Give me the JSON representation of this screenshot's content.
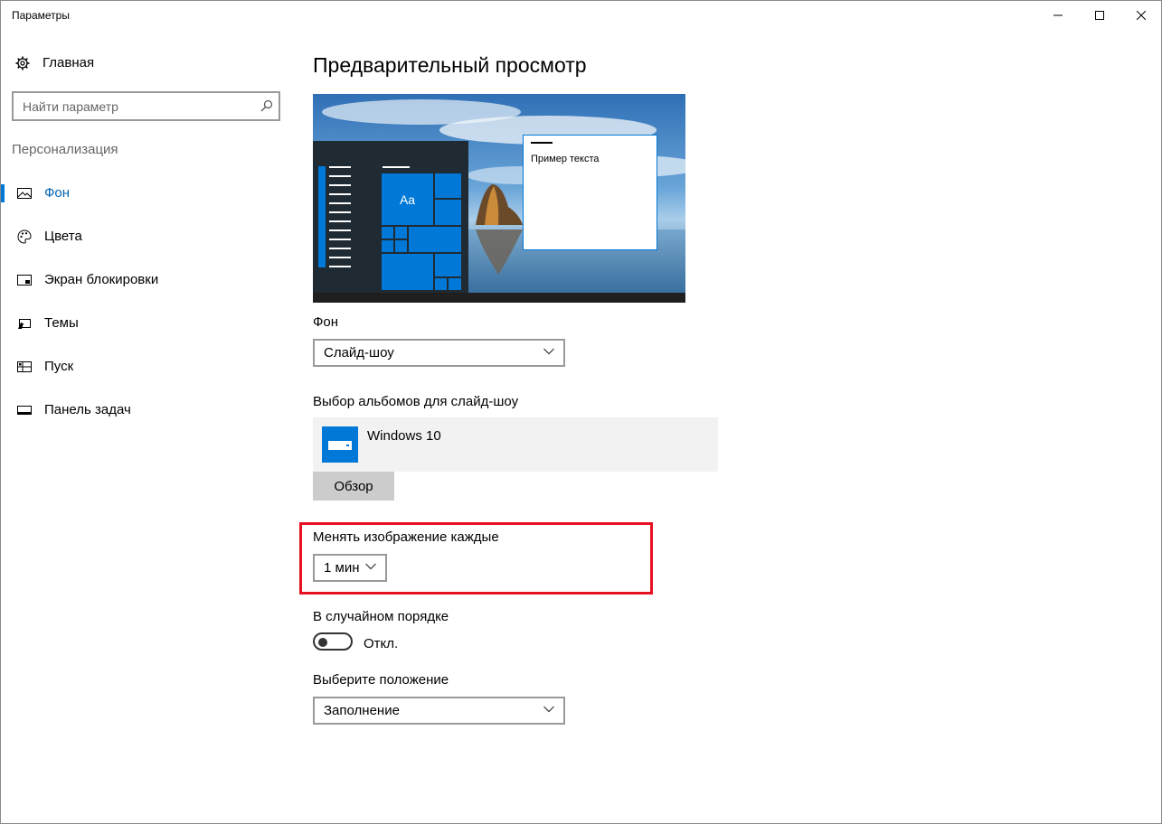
{
  "window": {
    "title": "Параметры",
    "controls": [
      "minimize",
      "maximize",
      "close"
    ]
  },
  "sidebar": {
    "home_label": "Главная",
    "search_placeholder": "Найти параметр",
    "section_title": "Персонализация",
    "items": [
      {
        "label": "Фон",
        "icon": "picture-icon",
        "active": true
      },
      {
        "label": "Цвета",
        "icon": "palette-icon",
        "active": false
      },
      {
        "label": "Экран блокировки",
        "icon": "lock-screen-icon",
        "active": false
      },
      {
        "label": "Темы",
        "icon": "themes-icon",
        "active": false
      },
      {
        "label": "Пуск",
        "icon": "start-icon",
        "active": false
      },
      {
        "label": "Панель задач",
        "icon": "taskbar-icon",
        "active": false
      }
    ]
  },
  "main": {
    "preview_title": "Предварительный просмотр",
    "preview": {
      "tile_text": "Aa",
      "sample_text": "Пример текста"
    },
    "background_label": "Фон",
    "background_value": "Слайд-шоу",
    "albums_label": "Выбор альбомов для слайд-шоу",
    "album_name": "Windows 10",
    "browse_label": "Обзор",
    "interval_label": "Менять изображение каждые",
    "interval_value": "1 мин",
    "shuffle_label": "В случайном порядке",
    "shuffle_state": "Откл.",
    "shuffle_on": false,
    "fit_label": "Выберите положение",
    "fit_value": "Заполнение"
  },
  "colors": {
    "accent": "#0078d7",
    "highlight_box": "#e81123"
  }
}
